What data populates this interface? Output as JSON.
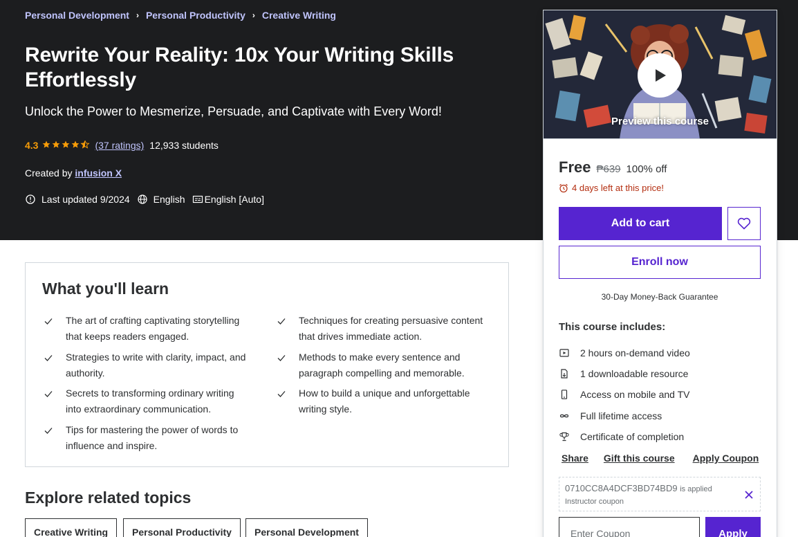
{
  "breadcrumb": [
    "Personal Development",
    "Personal Productivity",
    "Creative Writing"
  ],
  "course": {
    "title": "Rewrite Your Reality: 10x Your Writing Skills Effortlessly",
    "subtitle": "Unlock the Power to Mesmerize, Persuade, and Captivate with Every Word!",
    "rating": "4.3",
    "rating_value": 4.3,
    "ratings_link": "(37 ratings)",
    "students": "12,933 students",
    "created_by_label": "Created by",
    "instructor": "infusion X",
    "last_updated": "Last updated 9/2024",
    "language": "English",
    "captions": "English [Auto]"
  },
  "sidebar": {
    "preview_label": "Preview this course",
    "price": "Free",
    "original_price": "₱639",
    "discount": "100% off",
    "urgency": "4 days left at this price!",
    "add_to_cart": "Add to cart",
    "enroll": "Enroll now",
    "guarantee": "30-Day Money-Back Guarantee",
    "includes_title": "This course includes:",
    "includes": [
      {
        "icon": "video-icon",
        "text": "2 hours on-demand video"
      },
      {
        "icon": "file-download-icon",
        "text": "1 downloadable resource"
      },
      {
        "icon": "mobile-icon",
        "text": "Access on mobile and TV"
      },
      {
        "icon": "infinity-icon",
        "text": "Full lifetime access"
      },
      {
        "icon": "trophy-icon",
        "text": "Certificate of completion"
      }
    ],
    "actions": {
      "share": "Share",
      "gift": "Gift this course",
      "apply_coupon": "Apply Coupon"
    },
    "coupon": {
      "code": "0710CC8A4DCF3BD74BD9",
      "applied": "is applied",
      "type": "Instructor coupon",
      "input_placeholder": "Enter Coupon",
      "apply": "Apply"
    }
  },
  "learn": {
    "title": "What you'll learn",
    "items": [
      "The art of crafting captivating storytelling that keeps readers engaged.",
      "Techniques for creating persuasive content that drives immediate action.",
      "Strategies to write with clarity, impact, and authority.",
      "Methods to make every sentence and paragraph compelling and memorable.",
      "Secrets to transforming ordinary writing into extraordinary communication.",
      "How to build a unique and unforgettable writing style.",
      "Tips for mastering the power of words to influence and inspire."
    ]
  },
  "related": {
    "title": "Explore related topics",
    "topics": [
      "Creative Writing",
      "Personal Productivity",
      "Personal Development"
    ]
  },
  "colors": {
    "hero_bg": "#1c1d1f",
    "accent": "#5624d0",
    "link_light": "#c0c4fc",
    "star": "#f69c08",
    "urgency": "#b32d0f"
  }
}
